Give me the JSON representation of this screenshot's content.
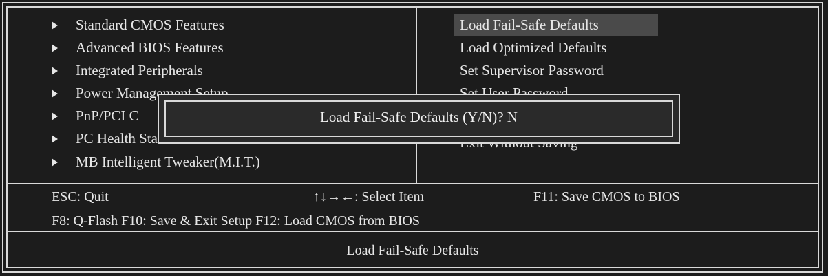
{
  "left_menu": [
    "Standard CMOS Features",
    "Advanced BIOS Features",
    "Integrated Peripherals",
    "Power Management Setup",
    "PnP/PCI C",
    "PC Health Status",
    "MB Intelligent Tweaker(M.I.T.)"
  ],
  "right_menu": [
    "Load Fail-Safe Defaults",
    "Load Optimized Defaults",
    "Set Supervisor Password",
    "Set User Password",
    "",
    "Exit Without Saving"
  ],
  "selected_item": "Load Fail-Safe Defaults",
  "dialog": {
    "prompt": "Load Fail-Safe Defaults (Y/N)? N"
  },
  "status": {
    "esc": "ESC: Quit",
    "select": "↑↓→←: Select Item",
    "f11": "F11: Save CMOS to BIOS",
    "line2": "F8: Q-Flash F10: Save & Exit Setup F12: Load CMOS from BIOS"
  },
  "help": "Load Fail-Safe Defaults",
  "colors": {
    "background": "#1c1c1c",
    "text": "#e6e6e6",
    "border": "#d9d9d9",
    "highlight": "#4a4a4a"
  }
}
